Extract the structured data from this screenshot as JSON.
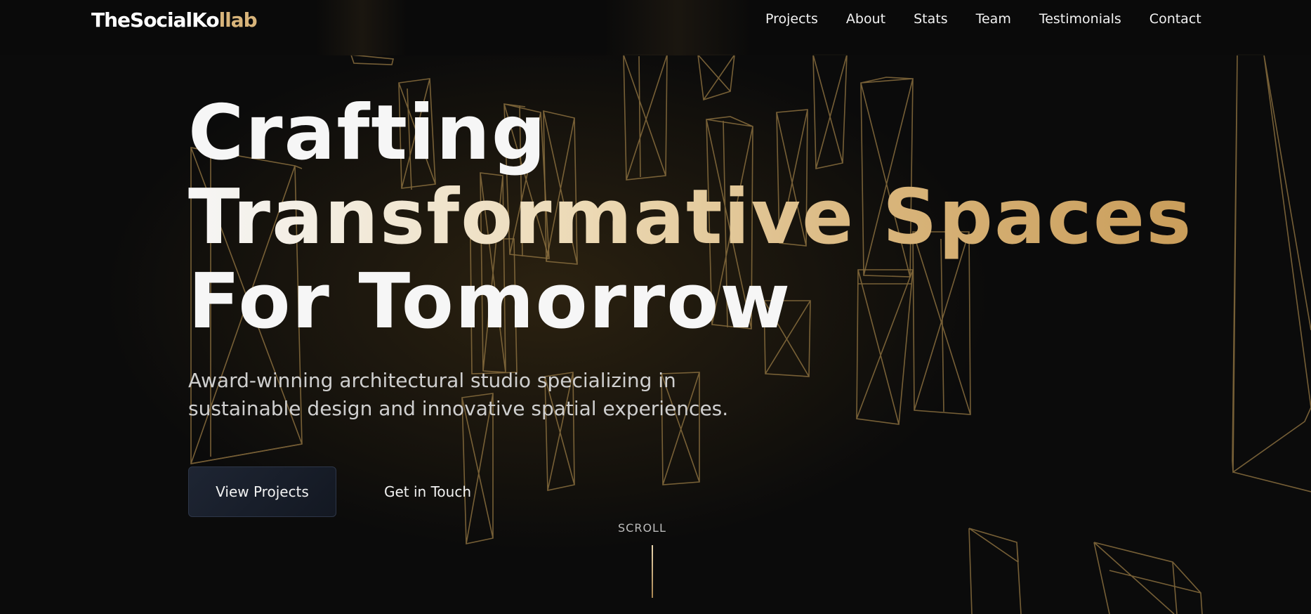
{
  "brand": {
    "name_main": "TheSocialKo",
    "name_accent": "llab",
    "accent_color": "#d8b47a"
  },
  "nav": {
    "items": [
      "Projects",
      "About",
      "Stats",
      "Team",
      "Testimonials",
      "Contact"
    ]
  },
  "hero": {
    "title_line1": "Crafting",
    "title_line2": "Transformative Spaces",
    "title_line3": "For Tomorrow",
    "subtitle": "Award-winning architectural studio specializing in sustainable design and innovative spatial experiences.",
    "primary_cta": "View Projects",
    "secondary_cta": "Get in Touch",
    "scroll_label": "SCROLL"
  },
  "colors": {
    "background": "#0b0b0b",
    "wireframe": "#8a6e3e",
    "gold": "#d8b47a",
    "button_bg": "#1a202c"
  }
}
